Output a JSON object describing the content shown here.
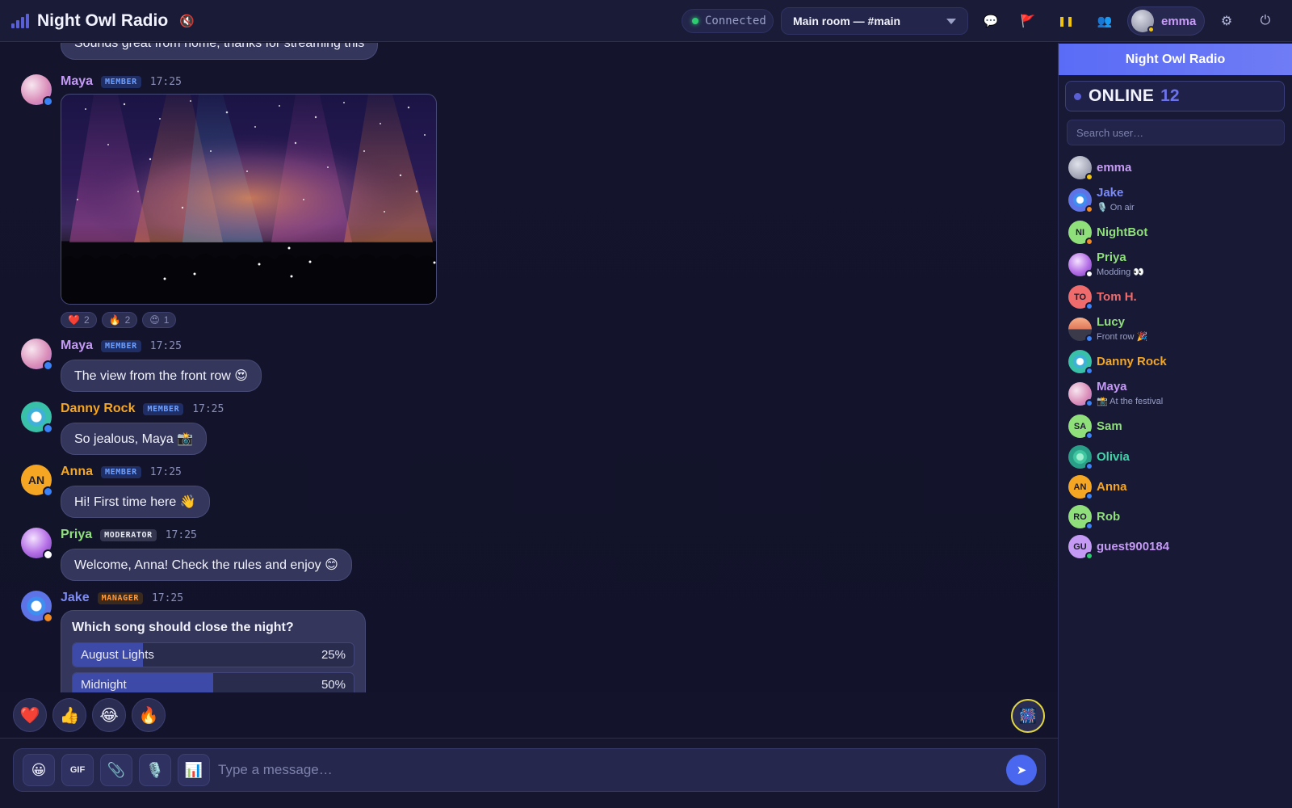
{
  "app": {
    "title": "Night Owl Radio"
  },
  "header": {
    "connection_status": "Connected",
    "room": "Main room — #main",
    "user": "emma"
  },
  "colors": {
    "accent": "#5a6cf6",
    "online": "#2ecc71",
    "away": "#f1c40f"
  },
  "chat": {
    "partial_message": "Sounds great from home, thanks for streaming this",
    "messages": [
      {
        "user": "Maya",
        "role": "MEMBER",
        "time": "17:25",
        "type": "image"
      },
      {
        "user": "Maya",
        "role": "MEMBER",
        "time": "17:25",
        "text": "The view from the front row 😍"
      },
      {
        "user": "Danny Rock",
        "role": "MEMBER",
        "time": "17:25",
        "text": "So jealous, Maya 📸"
      },
      {
        "user": "Anna",
        "role": "MEMBER",
        "time": "17:25",
        "text": "Hi! First time here 👋",
        "initials": "AN"
      },
      {
        "user": "Priya",
        "role": "MODERATOR",
        "time": "17:25",
        "text": "Welcome, Anna! Check the rules and enjoy 😊"
      },
      {
        "user": "Jake",
        "role": "MANAGER",
        "time": "17:25",
        "type": "poll"
      }
    ],
    "image_reactions": [
      {
        "emoji": "❤️",
        "count": "2"
      },
      {
        "emoji": "🔥",
        "count": "2"
      },
      {
        "emoji": "😍",
        "count": "1"
      }
    ],
    "poll": {
      "question": "Which song should close the night?",
      "options": [
        {
          "label": "August Lights",
          "percent_text": "25%",
          "percent": 25
        },
        {
          "label": "Midnight",
          "percent_text": "50%",
          "percent": 50
        }
      ]
    }
  },
  "quick_reactions": [
    "❤️",
    "👍",
    "😂",
    "🔥"
  ],
  "effects_button": "🎆",
  "composer": {
    "emoji": "😀",
    "gif": "GIF",
    "attach": "📎",
    "mic": "🎙️",
    "poll": "📊",
    "placeholder": "Type a message…",
    "send": "➤"
  },
  "sidebar": {
    "title": "Night Owl Radio",
    "online_label": "ONLINE",
    "online_count": "12",
    "search_placeholder": "Search user…",
    "users": [
      {
        "name": "emma",
        "status": ""
      },
      {
        "name": "Jake",
        "status": "🎙️ On air"
      },
      {
        "name": "NightBot",
        "status": "",
        "initials": "NI"
      },
      {
        "name": "Priya",
        "status": "Modding 👀"
      },
      {
        "name": "Tom H.",
        "status": "",
        "initials": "TO"
      },
      {
        "name": "Lucy",
        "status": "Front row 🎉"
      },
      {
        "name": "Danny Rock",
        "status": ""
      },
      {
        "name": "Maya",
        "status": "📸 At the festival"
      },
      {
        "name": "Sam",
        "status": "",
        "initials": "SA"
      },
      {
        "name": "Olivia",
        "status": ""
      },
      {
        "name": "Anna",
        "status": "",
        "initials": "AN"
      },
      {
        "name": "Rob",
        "status": "",
        "initials": "RO"
      },
      {
        "name": "guest900184",
        "status": "",
        "initials": "GU"
      }
    ]
  }
}
